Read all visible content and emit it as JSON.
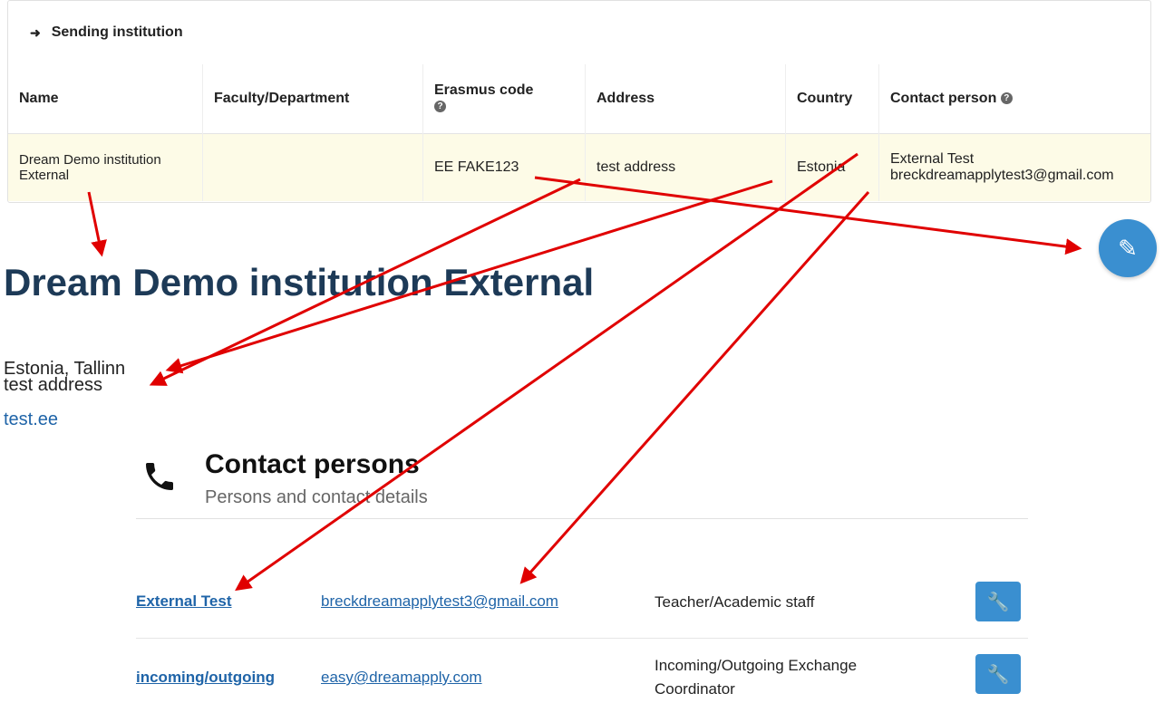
{
  "panel": {
    "title": "Sending institution",
    "columns": [
      "Name",
      "Faculty/Department",
      "Erasmus code",
      "Address",
      "Country",
      "Contact person"
    ],
    "row": {
      "name": "Dream Demo institution External",
      "faculty": "",
      "erasmus_code": "EE FAKE123",
      "address": "test address",
      "country": "Estonia",
      "contact_name": "External Test",
      "contact_email": "breckdreamapplytest3@gmail.com"
    }
  },
  "institution": {
    "title": "Dream Demo institution External",
    "location": "Estonia, Tallinn",
    "address": "test address",
    "website": "test.ee"
  },
  "contacts": {
    "title": "Contact persons",
    "subtitle": "Persons and contact details",
    "rows": [
      {
        "name": "External Test",
        "email": "breckdreamapplytest3@gmail.com",
        "role": "Teacher/Academic staff"
      },
      {
        "name": "incoming/outgoing",
        "email": "easy@dreamapply.com",
        "role": "Incoming/Outgoing Exchange Coordinator"
      }
    ]
  },
  "colors": {
    "accent": "#3a8fd0",
    "title": "#1d3a57",
    "link": "#1f64a8",
    "highlight_row": "#fdfbe7",
    "arrow": "#e00000"
  },
  "icons": {
    "sending": "sign-out-icon",
    "help": "question-circle-icon",
    "edit": "pencil-icon",
    "phone": "phone-icon",
    "wrench": "wrench-icon"
  }
}
